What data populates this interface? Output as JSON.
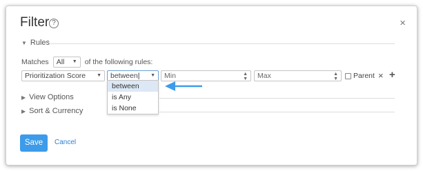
{
  "dialog": {
    "title": "Filter",
    "help_icon": "?",
    "close_icon": "×"
  },
  "rules": {
    "section_label": "Rules",
    "matches_label": "Matches",
    "matches_value": "All",
    "matches_suffix": "of the following rules:",
    "rule": {
      "field": "Prioritization Score",
      "operator": "between",
      "min_placeholder": "Min",
      "max_placeholder": "Max",
      "parent_label": "Parent",
      "remove_icon": "×",
      "add_icon": "+"
    },
    "operator_options": [
      "between",
      "is Any",
      "is None"
    ]
  },
  "view_options": {
    "label": "View Options"
  },
  "sort_currency": {
    "label": "Sort & Currency"
  },
  "footer": {
    "save_label": "Save",
    "cancel_label": "Cancel"
  },
  "colors": {
    "accent": "#3d9be9",
    "annotation_arrow": "#3d9be9",
    "link": "#2b7fd4"
  }
}
